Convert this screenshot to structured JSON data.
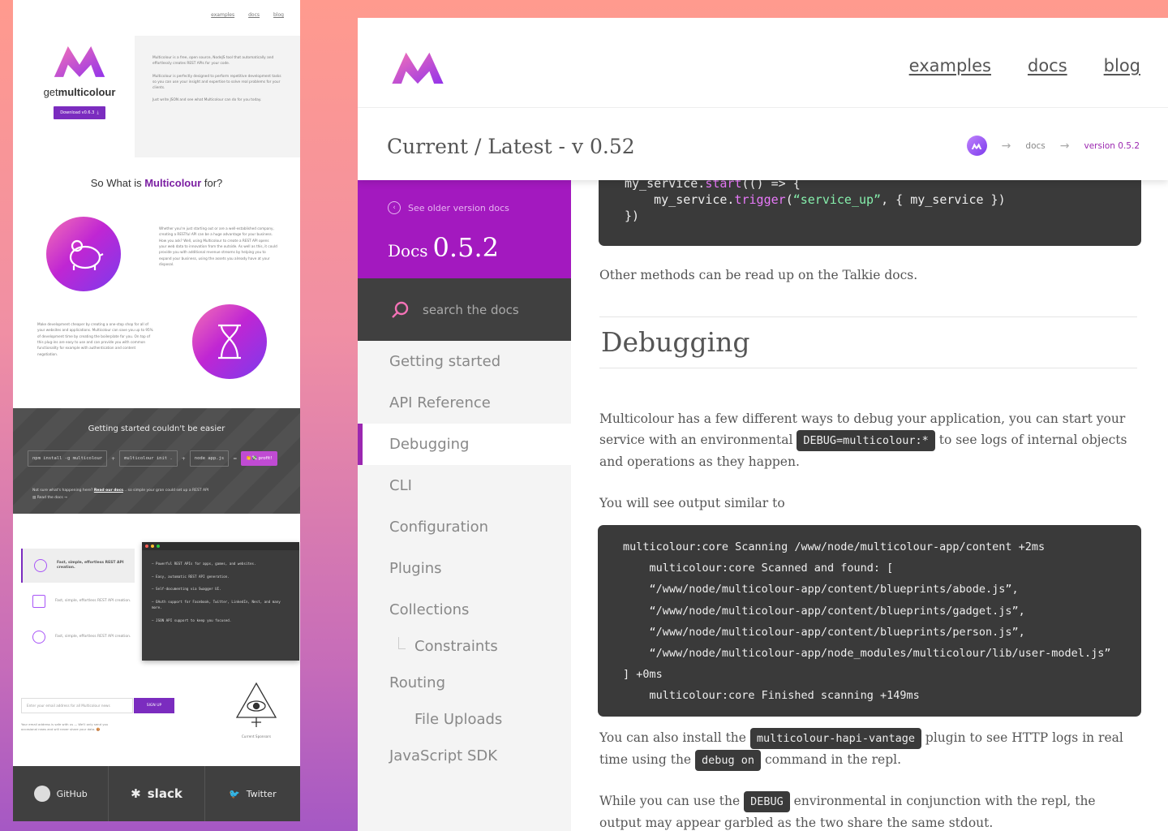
{
  "left": {
    "nav": [
      "examples",
      "docs",
      "blog"
    ],
    "brand_pre": "get",
    "brand_bold": "multicolour",
    "download_label": "Download v0.6.3",
    "hero_paragraphs": [
      "Multicolour is a free, open source, NodeJS tool that automatically and effortlessly creates REST APIs for your code.",
      "Multicolour is perfectly designed to perform repetitive development tasks so you can use your insight and expertise to solve real problems for your clients.",
      "Just write JSON and see what Multicolour can do for you today."
    ],
    "what_pre": "So What is ",
    "what_bold": "Multicolour",
    "what_post": " for?",
    "feature1_text": "Whether you're just starting out or are a well-established company, creating a RESTful API can be a huge advantage for your business. How you ask? Well, using Multicolour to create a REST API opens your web data to innovation from the outside. As well as this, it could provide you with additional revenue streams by helping you to expand your business, using the assets you already have at your disposal.",
    "feature2_text": "Make development cheaper by creating a one-stop shop for all of your websites and applications. Multicolour can save you up to 95% of development time by creating the boilerplate for you. On top of this plug-ins are easy to use and can provide you with common functionality for example with authentication and content negotiation.",
    "band_title": "Getting started couldn't be easier",
    "commands": [
      "npm install -g multicolour",
      "multicolour init .",
      "node app.js"
    ],
    "profit_label": "👏💸 profit!",
    "band_note_pre": "Not sure what's happening here? ",
    "band_note_link": "Read our docs",
    "band_note_post": "... so simple your gran could set up a REST API",
    "read_docs": "Read the docs →",
    "feature_tabs": [
      "Fast, simple, effortless REST API creation.",
      "Fast, simple, effortless REST API creation.",
      "Fast, simple, effortless REST API creation."
    ],
    "code_items": [
      "Powerful REST APIs for apps, games, and websites.",
      "Easy, automatic REST API generation.",
      "Self-documenting via Swagger UI.",
      "OAuth support for Facebook, Twitter, LinkedIn, Nest, and many more.",
      "JSON API support to keep you focused."
    ],
    "newsletter_placeholder": "Enter your email address for all Multicolour news",
    "signup_label": "SIGN UP",
    "newsletter_note": "Your email address is safe with us — We'll only send you occasional news and will never share your data. 🍪",
    "sponsors_label": "Current Sponsors",
    "footer": [
      "GitHub",
      "slack",
      "Twitter"
    ],
    "colors": {
      "brand": "#7b2cbf",
      "accent": "#a319bf",
      "dark": "#404040"
    }
  },
  "right": {
    "nav": [
      "examples",
      "docs",
      "blog"
    ],
    "title": "Current / Latest - v 0.52",
    "breadcrumb": [
      "docs",
      "version 0.5.2"
    ],
    "older_docs": "See older version docs",
    "docs_label": "Docs",
    "docs_version": "0.5.2",
    "search_placeholder": "search the docs",
    "sidebar_items": [
      "Getting started",
      "API Reference",
      "Debugging",
      "CLI",
      "Configuration",
      "Plugins",
      "Collections",
      "Constraints",
      "Routing",
      "File Uploads",
      "JavaScript SDK"
    ],
    "code_top": {
      "l1a": "my_service.",
      "l1fn": "start",
      "l1b": "(() => {",
      "l2a": "    my_service.",
      "l2fn": "trigger",
      "l2b": "(",
      "l2str": "“service_up”",
      "l2c": ", { my_service })",
      "l3": "})"
    },
    "p_other": "Other methods can be read up on the Talkie docs.",
    "h_debugging": "Debugging",
    "p_debug_a": "Multicolour has a few different ways to debug your application, you can start your service with an environmental ",
    "code_debug_env": "DEBUG=multicolour:*",
    "p_debug_b": " to see logs of internal objects and operations as they happen.",
    "p_output": "You will see output similar to",
    "output_lines": [
      "multicolour:core Scanning /www/node/multicolour-app/content +2ms",
      "    multicolour:core Scanned and found: [",
      "    “/www/node/multicolour-app/content/blueprints/abode.js”,",
      "    “/www/node/multicolour-app/content/blueprints/gadget.js”,",
      "    “/www/node/multicolour-app/content/blueprints/person.js”,",
      "    “/www/node/multicolour-app/node_modules/multicolour/lib/user-model.js”",
      "] +0ms",
      "    multicolour:core Finished scanning +149ms"
    ],
    "p_install_a": "You can also install the ",
    "code_vantage": "multicolour-hapi-vantage",
    "p_install_b": " plugin to see HTTP logs in real time using the ",
    "code_debug_on": "debug on",
    "p_install_c": " command in the repl.",
    "p_while_a": "While you can use the ",
    "code_debug": "DEBUG",
    "p_while_b": " environmental in conjunction with the repl, the output may appear garbled as the two share the same stdout."
  }
}
